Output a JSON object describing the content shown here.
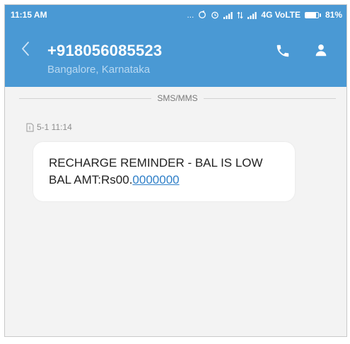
{
  "status_bar": {
    "time": "11:15 AM",
    "indicators": "... ",
    "network": "4G VoLTE",
    "battery_text": "81%",
    "battery_level": 0.81
  },
  "header": {
    "phone_number": "+918056085523",
    "location": "Bangalore, Karnataka",
    "back_icon": "chevron-left-icon",
    "call_icon": "phone-icon",
    "contact_icon": "person-icon",
    "background_color": "#4a99d4"
  },
  "thread": {
    "divider_label": "SMS/MMS",
    "message": {
      "timestamp": "5-1 11:14",
      "line1": "RECHARGE REMINDER - BAL IS LOW",
      "line2_prefix": "BAL AMT:Rs00.",
      "line2_link": "0000000",
      "link_color": "#2f7fc8"
    }
  }
}
